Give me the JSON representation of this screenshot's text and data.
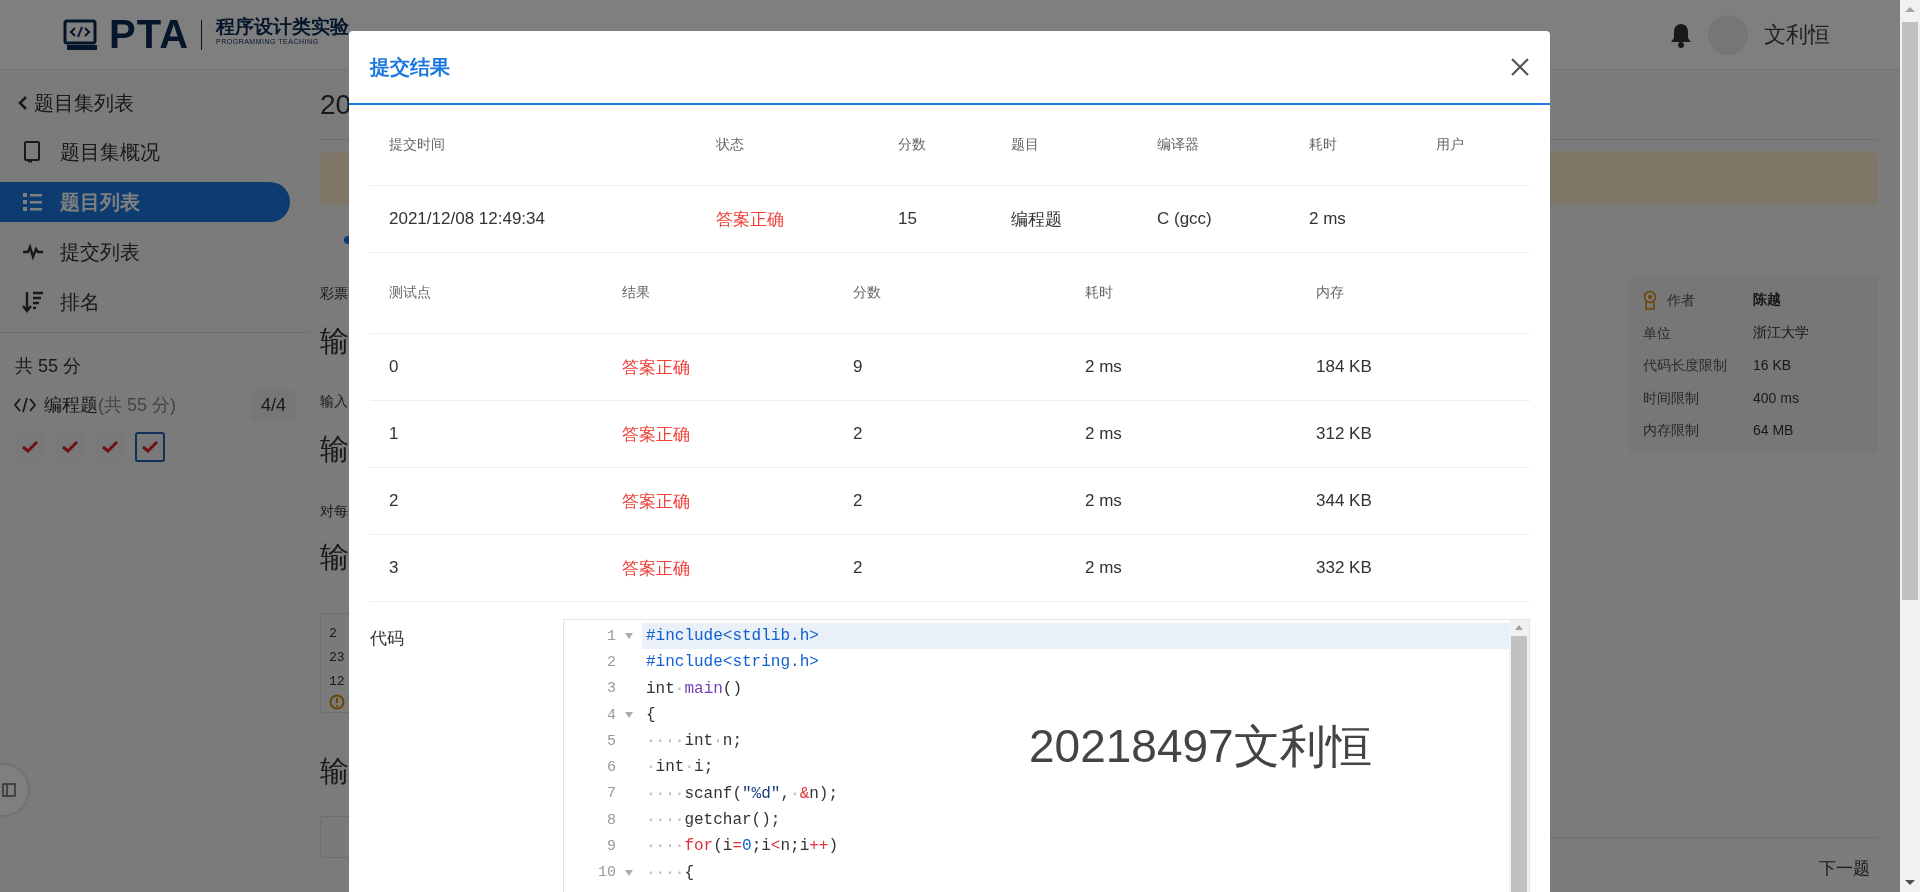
{
  "header": {
    "logo_text": "PTA",
    "logo_subtitle": "程序设计类实验",
    "logo_tagline": "PROGRAMMING TEACHING",
    "user_name": "文利恒"
  },
  "sidebar": {
    "back_link": "题目集列表",
    "items": [
      {
        "label": "题目集概况",
        "selected": false
      },
      {
        "label": "题目列表",
        "selected": true
      },
      {
        "label": "提交列表",
        "selected": false
      },
      {
        "label": "排名",
        "selected": false
      }
    ],
    "total": "共 55 分",
    "section": {
      "label": "编程题",
      "points": "(共 55 分)",
      "progress": "4/4"
    },
    "problems": [
      {
        "passed": true,
        "selected": false
      },
      {
        "passed": true,
        "selected": false
      },
      {
        "passed": true,
        "selected": false
      },
      {
        "passed": true,
        "selected": true
      }
    ]
  },
  "content": [
    {
      "kind": "title",
      "text": "20"
    },
    {
      "kind": "notice"
    },
    {
      "kind": "tab-dot"
    },
    {
      "kind": "para",
      "text": "彩票"
    },
    {
      "kind": "heading",
      "text": "输"
    },
    {
      "kind": "para",
      "text": "输入"
    },
    {
      "kind": "heading",
      "text": "输"
    },
    {
      "kind": "para",
      "text": "对每"
    },
    {
      "kind": "heading",
      "text": "输"
    },
    {
      "kind": "sample",
      "lines": [
        "2",
        "23",
        "12"
      ]
    },
    {
      "kind": "heading",
      "text": "输"
    },
    {
      "kind": "sample-top"
    }
  ],
  "info_card": [
    {
      "label": "作者",
      "value": "陈越",
      "kind": "author"
    },
    {
      "label": "单位",
      "value": "浙江大学",
      "kind": "plain"
    },
    {
      "label": "代码长度限制",
      "value": "16 KB",
      "kind": "plain"
    },
    {
      "label": "时间限制",
      "value": "400 ms",
      "kind": "plain"
    },
    {
      "label": "内存限制",
      "value": "64 MB",
      "kind": "plain"
    }
  ],
  "next_button": "下一题",
  "dialog": {
    "title": "提交结果",
    "summary": {
      "columns": [
        "提交时间",
        "状态",
        "分数",
        "题目",
        "编译器",
        "耗时",
        "用户"
      ],
      "rows": [
        {
          "time": "2021/12/08 12:49:34",
          "status": "答案正确",
          "kind": "accepted",
          "score": "15",
          "problem": "编程题",
          "compiler": "C (gcc)",
          "elapsed": "2 ms"
        }
      ]
    },
    "tests": {
      "columns": [
        "测试点",
        "结果",
        "分数",
        "耗时",
        "内存"
      ],
      "rows": [
        {
          "case": "0",
          "status": "答案正确",
          "kind": "accepted",
          "score": "9",
          "elapsed": "2 ms",
          "memory": "184 KB"
        },
        {
          "case": "1",
          "status": "答案正确",
          "kind": "accepted",
          "score": "2",
          "elapsed": "2 ms",
          "memory": "312 KB"
        },
        {
          "case": "2",
          "status": "答案正确",
          "kind": "accepted",
          "score": "2",
          "elapsed": "2 ms",
          "memory": "344 KB"
        },
        {
          "case": "3",
          "status": "答案正确",
          "kind": "accepted",
          "score": "2",
          "elapsed": "2 ms",
          "memory": "332 KB"
        }
      ]
    },
    "code_label": "代码",
    "code": {
      "overlay_text": "20218497文利恒",
      "lines": [
        {
          "number": "1",
          "foldable": true,
          "active": true,
          "tokens": [
            {
              "t": "#include<stdlib.h>",
              "kind": "dir"
            }
          ]
        },
        {
          "number": "2",
          "foldable": false,
          "active": false,
          "tokens": [
            {
              "t": "#include<string.h>",
              "kind": "dir"
            }
          ]
        },
        {
          "number": "3",
          "foldable": false,
          "active": false,
          "tokens": [
            {
              "t": "int",
              "kind": "plain"
            },
            {
              "t": "·",
              "kind": "ws"
            },
            {
              "t": "main",
              "kind": "fn"
            },
            {
              "t": "()",
              "kind": "plain"
            }
          ]
        },
        {
          "number": "4",
          "foldable": true,
          "active": false,
          "tokens": [
            {
              "t": "{",
              "kind": "plain"
            }
          ]
        },
        {
          "number": "5",
          "foldable": false,
          "active": false,
          "tokens": [
            {
              "t": "····",
              "kind": "ws"
            },
            {
              "t": "int",
              "kind": "plain"
            },
            {
              "t": "·",
              "kind": "ws"
            },
            {
              "t": "n;",
              "kind": "plain"
            }
          ]
        },
        {
          "number": "6",
          "foldable": false,
          "active": false,
          "tokens": [
            {
              "t": "·",
              "kind": "ws"
            },
            {
              "t": "int",
              "kind": "plain"
            },
            {
              "t": "·",
              "kind": "ws"
            },
            {
              "t": "i;",
              "kind": "plain"
            }
          ]
        },
        {
          "number": "7",
          "foldable": false,
          "active": false,
          "tokens": [
            {
              "t": "····",
              "kind": "ws"
            },
            {
              "t": "scanf(",
              "kind": "plain"
            },
            {
              "t": "\"%d\"",
              "kind": "str"
            },
            {
              "t": ",",
              "kind": "plain"
            },
            {
              "t": "·",
              "kind": "ws"
            },
            {
              "t": "&",
              "kind": "op"
            },
            {
              "t": "n);",
              "kind": "plain"
            }
          ]
        },
        {
          "number": "8",
          "foldable": false,
          "active": false,
          "tokens": [
            {
              "t": "····",
              "kind": "ws"
            },
            {
              "t": "getchar();",
              "kind": "plain"
            }
          ]
        },
        {
          "number": "9",
          "foldable": false,
          "active": false,
          "tokens": [
            {
              "t": "····",
              "kind": "ws"
            },
            {
              "t": "for",
              "kind": "op"
            },
            {
              "t": "(i",
              "kind": "plain"
            },
            {
              "t": "=",
              "kind": "op"
            },
            {
              "t": "0",
              "kind": "num"
            },
            {
              "t": ";i",
              "kind": "plain"
            },
            {
              "t": "<",
              "kind": "op"
            },
            {
              "t": "n;i",
              "kind": "plain"
            },
            {
              "t": "++",
              "kind": "op"
            },
            {
              "t": ")",
              "kind": "plain"
            }
          ]
        },
        {
          "number": "10",
          "foldable": true,
          "active": false,
          "tokens": [
            {
              "t": "····",
              "kind": "ws"
            },
            {
              "t": "{",
              "kind": "plain"
            }
          ]
        }
      ]
    }
  }
}
